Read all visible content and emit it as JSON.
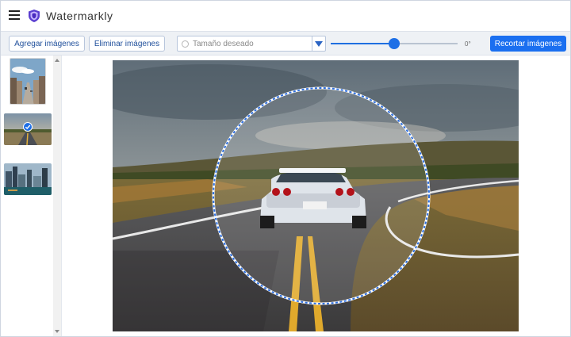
{
  "app": {
    "name": "Watermarkly"
  },
  "toolbar": {
    "add_label": "Agregar imágenes",
    "remove_label": "Eliminar imágenes",
    "size_placeholder": "Tamaño deseado",
    "rotation_label": "0°",
    "rotation_value": 0.5,
    "crop_label": "Recortar imágenes"
  },
  "sidebar": {
    "thumbnails": [
      {
        "name": "city-street",
        "selected": false
      },
      {
        "name": "road-car",
        "selected": true
      },
      {
        "name": "city-waterfront",
        "selected": false
      }
    ]
  },
  "editor": {
    "crop_shape": "circle"
  },
  "colors": {
    "accent": "#1a6ff0",
    "brand": "#5b3fd0"
  }
}
